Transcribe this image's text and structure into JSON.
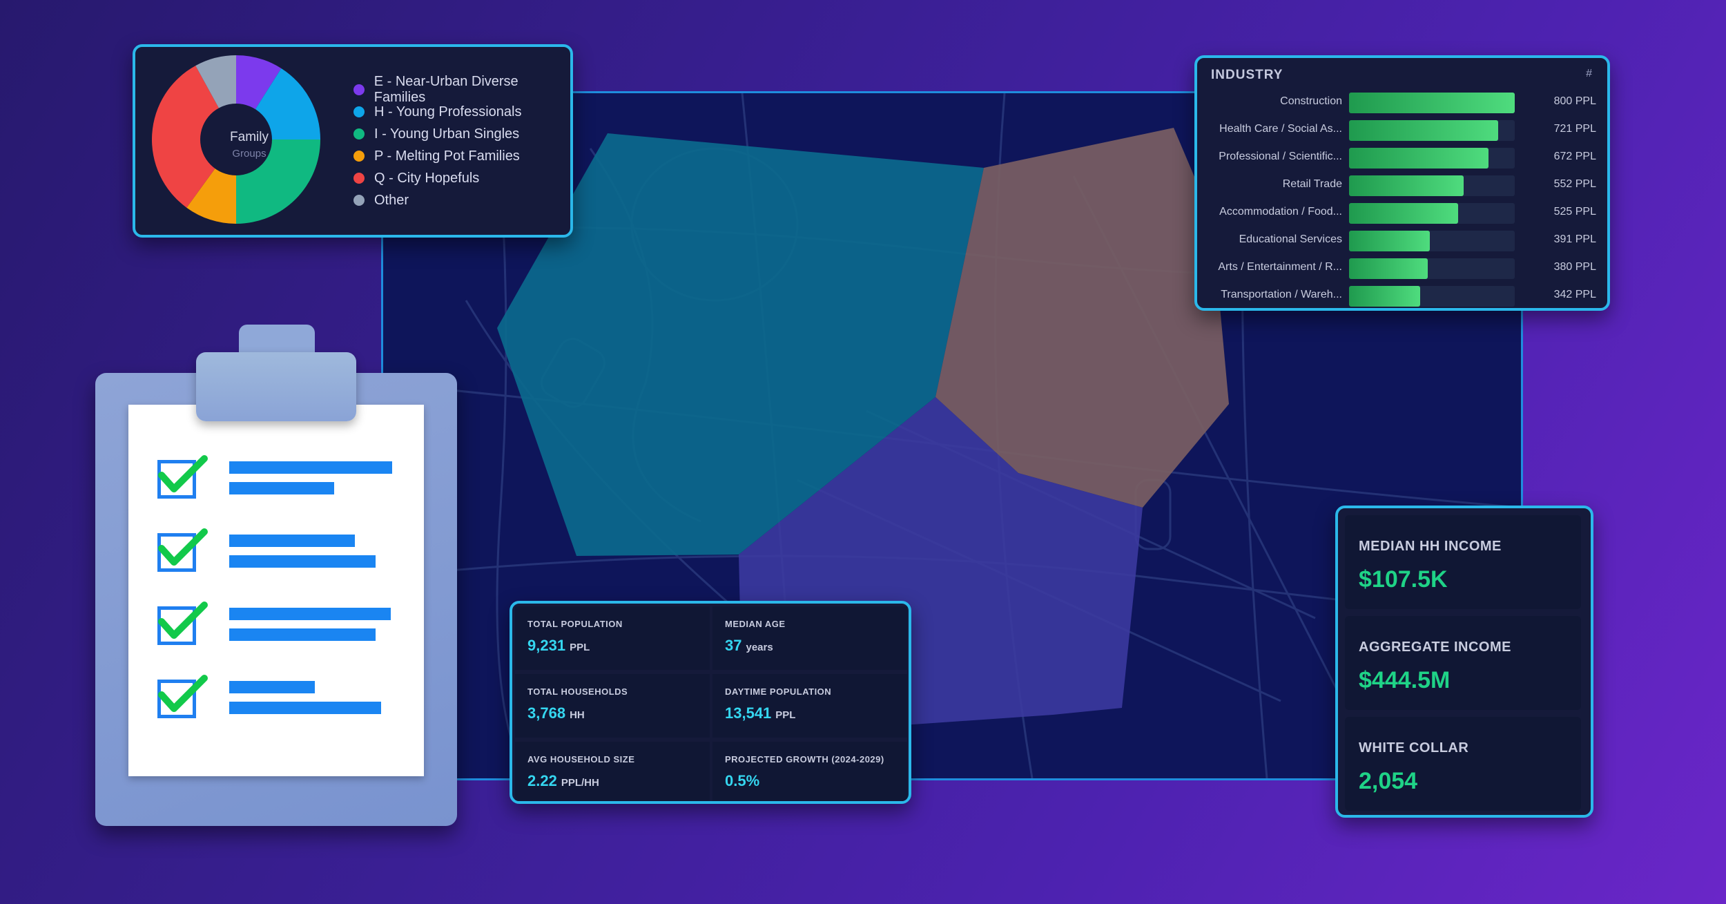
{
  "family_groups": {
    "center_title": "Family",
    "center_subtitle": "Groups",
    "legend": [
      {
        "label": "E - Near-Urban Diverse Families",
        "color": "#7c3aed"
      },
      {
        "label": "H - Young Professionals",
        "color": "#0ea5e9"
      },
      {
        "label": "I - Young Urban Singles",
        "color": "#10b981"
      },
      {
        "label": "P - Melting Pot Families",
        "color": "#f59e0b"
      },
      {
        "label": "Q - City Hopefuls",
        "color": "#ef4444"
      },
      {
        "label": "Other",
        "color": "#94a3b8"
      }
    ]
  },
  "chart_data": [
    {
      "type": "pie",
      "title": "Family Groups",
      "categories": [
        "E - Near-Urban Diverse Families",
        "H - Young Professionals",
        "I - Young Urban Singles",
        "P - Melting Pot Families",
        "Q - City Hopefuls",
        "Other"
      ],
      "values": [
        9,
        16,
        25,
        10,
        32,
        8
      ],
      "colors": [
        "#7c3aed",
        "#0ea5e9",
        "#10b981",
        "#f59e0b",
        "#ef4444",
        "#94a3b8"
      ]
    },
    {
      "type": "bar",
      "title": "INDUSTRY",
      "categories": [
        "Construction",
        "Health Care / Social As...",
        "Professional / Scientific...",
        "Retail Trade",
        "Accommodation / Food...",
        "Educational Services",
        "Arts / Entertainment / R...",
        "Transportation / Wareh..."
      ],
      "values": [
        800,
        721,
        672,
        552,
        525,
        391,
        380,
        342
      ],
      "unit": "PPL",
      "ylim": [
        0,
        800
      ]
    }
  ],
  "industry": {
    "title": "INDUSTRY",
    "hash": "#",
    "rows": [
      {
        "label": "Construction",
        "value": "800 PPL"
      },
      {
        "label": "Health Care / Social As...",
        "value": "721 PPL"
      },
      {
        "label": "Professional / Scientific...",
        "value": "672 PPL"
      },
      {
        "label": "Retail Trade",
        "value": "552 PPL"
      },
      {
        "label": "Accommodation / Food...",
        "value": "525 PPL"
      },
      {
        "label": "Educational Services",
        "value": "391 PPL"
      },
      {
        "label": "Arts / Entertainment / R...",
        "value": "380 PPL"
      },
      {
        "label": "Transportation / Wareh...",
        "value": "342 PPL"
      }
    ]
  },
  "stats": [
    {
      "label": "TOTAL POPULATION",
      "value": "9,231",
      "unit": "PPL"
    },
    {
      "label": "MEDIAN AGE",
      "value": "37",
      "unit": "years"
    },
    {
      "label": "TOTAL HOUSEHOLDS",
      "value": "3,768",
      "unit": "HH"
    },
    {
      "label": "DAYTIME POPULATION",
      "value": "13,541",
      "unit": "PPL"
    },
    {
      "label": "AVG HOUSEHOLD SIZE",
      "value": "2.22",
      "unit": "PPL/HH"
    },
    {
      "label": "PROJECTED GROWTH (2024-2029)",
      "value": "0.5%",
      "unit": ""
    }
  ],
  "income": [
    {
      "label": "MEDIAN HH INCOME",
      "value": "$107.5K"
    },
    {
      "label": "AGGREGATE INCOME",
      "value": "$444.5M"
    },
    {
      "label": "WHITE COLLAR",
      "value": "2,054"
    }
  ],
  "colors": {
    "panel_border": "#2bb8ea",
    "accent_cyan": "#35d6f0",
    "accent_green": "#1fd387",
    "map_teal": "#0b6a8e",
    "map_tan": "#7a5e63",
    "map_indigo": "#3c3aa0"
  }
}
